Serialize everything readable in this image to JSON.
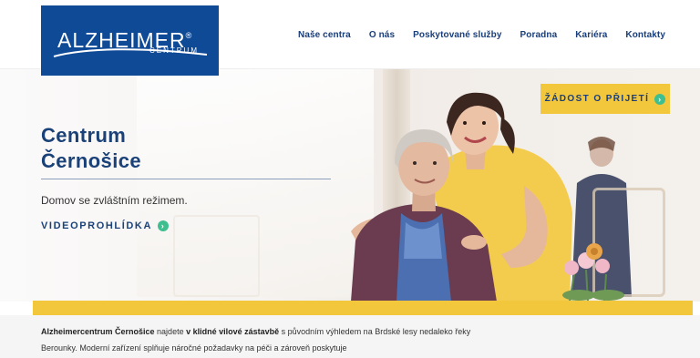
{
  "header": {
    "logo_main": "ALZHEIMER",
    "logo_registered": "®",
    "logo_sub": "CENTRUM",
    "nav": [
      "Naše centra",
      "O nás",
      "Poskytované služby",
      "Poradna",
      "Kariéra",
      "Kontakty"
    ]
  },
  "hero": {
    "title": "Centrum\nČernošice",
    "subtitle": "Domov se zvláštním režimem.",
    "video_label": "VIDEOPROHLÍDKA",
    "cta_label": "ŽÁDOST O PŘIJETÍ"
  },
  "intro": {
    "part1_bold": "Alzheimercentrum Černošice",
    "part2": " najdete ",
    "part3_bold": "v klidné vilové zástavbě",
    "part4": " s původním výhledem na Brdské lesy nedaleko řeky Berounky. Moderní zařízení splňuje náročné požadavky na péči a zároveň poskytuje"
  },
  "colors": {
    "brand_blue": "#0f4a97",
    "accent_yellow": "#f3c73c",
    "accent_green": "#3fbf8f",
    "title_blue": "#1a4178"
  },
  "icons": {
    "cta_arrow": "arrow-right-circle-icon",
    "video_arrow": "arrow-right-circle-icon"
  }
}
